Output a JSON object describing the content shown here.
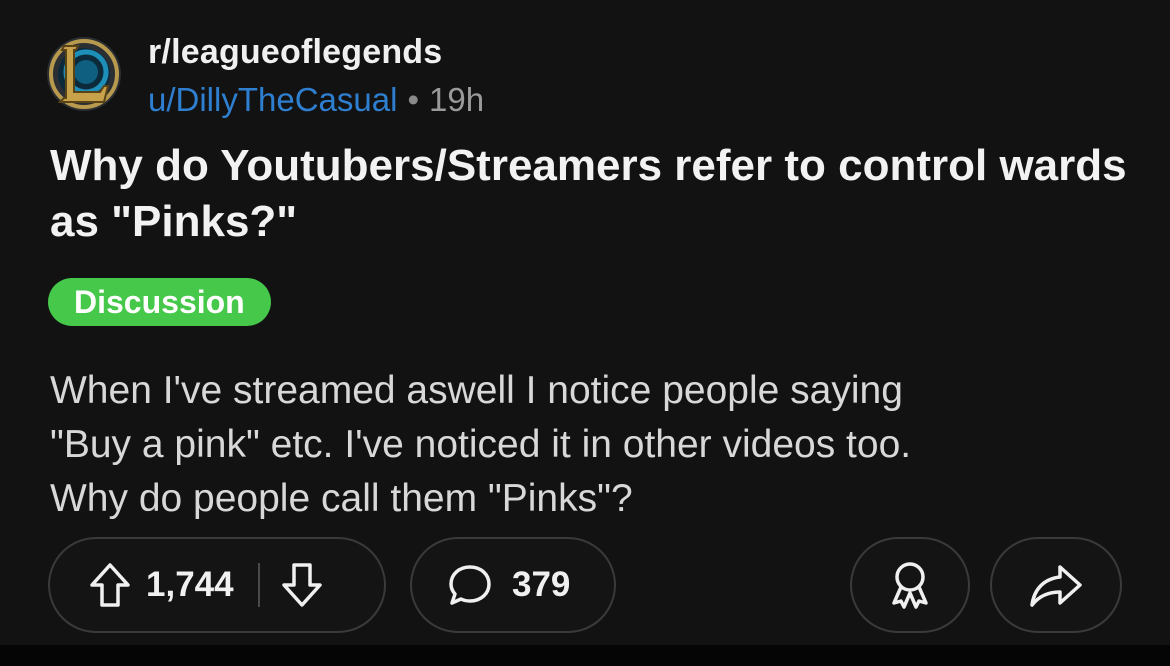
{
  "post": {
    "subreddit": "r/leagueoflegends",
    "username": "u/DillyTheCasual",
    "separator": "•",
    "time": "19h",
    "title": "Why do Youtubers/Streamers refer to control wards as \"Pinks?\"",
    "flair": "Discussion",
    "body_lines": [
      "When I've streamed aswell I notice people saying",
      "\"Buy a pink\" etc.  I've noticed it in other videos too.",
      "Why do people call them \"Pinks\"?"
    ]
  },
  "actions": {
    "upvotes": "1,744",
    "comments": "379"
  },
  "icons": {
    "avatar": "league-of-legends-logo",
    "upvote": "arrow-up-icon",
    "downvote": "arrow-down-icon",
    "comment": "speech-bubble-icon",
    "award": "award-ribbon-icon",
    "share": "share-arrow-icon"
  },
  "colors": {
    "background": "#121213",
    "username": "#2f7fd0",
    "flair_bg": "#46c84a",
    "pill_border": "#3a3a3c"
  }
}
